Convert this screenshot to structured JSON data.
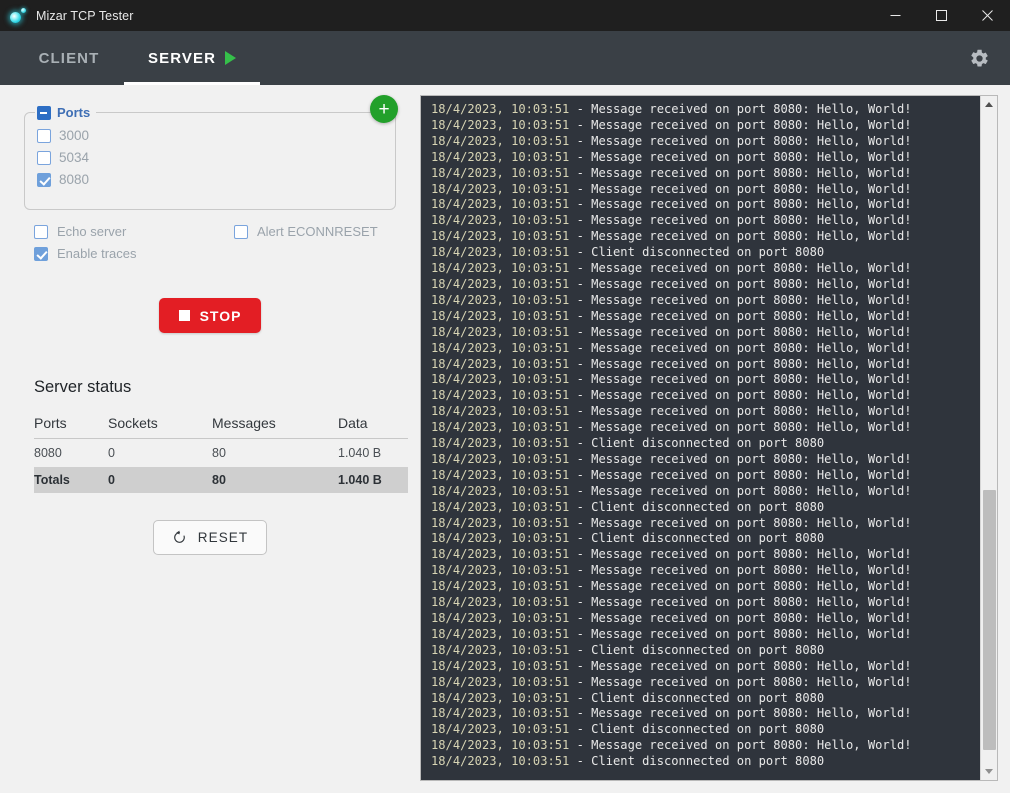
{
  "window": {
    "title": "Mizar TCP Tester",
    "controls": {
      "minimize": "minimize-icon",
      "maximize": "maximize-icon",
      "close": "close-icon"
    }
  },
  "tabs": [
    {
      "label": "CLIENT",
      "active": false,
      "icon": null
    },
    {
      "label": "SERVER",
      "active": true,
      "icon": "play-icon"
    }
  ],
  "toolbar": {
    "settings_icon": "gear-icon"
  },
  "ports_panel": {
    "legend": "Ports",
    "legend_state": "indeterminate",
    "add_button": "+",
    "items": [
      {
        "label": "3000",
        "checked": false
      },
      {
        "label": "5034",
        "checked": false
      },
      {
        "label": "8080",
        "checked": true
      }
    ]
  },
  "options": [
    {
      "label": "Echo server",
      "checked": false
    },
    {
      "label": "Enable traces",
      "checked": true
    },
    {
      "label": "Alert ECONNRESET",
      "checked": false
    }
  ],
  "stop_button": {
    "label": "STOP",
    "icon": "stop-square-icon",
    "color": "#e31e24"
  },
  "server_status": {
    "title": "Server status",
    "columns": [
      "Ports",
      "Sockets",
      "Messages",
      "Data"
    ],
    "rows": [
      [
        "8080",
        "0",
        "80",
        "1.040 B"
      ]
    ],
    "totals": [
      "Totals",
      "0",
      "80",
      "1.040 B"
    ]
  },
  "reset_button": {
    "label": "RESET",
    "icon": "refresh-icon"
  },
  "console": {
    "timestamp": "18/4/2023, 10:03:51",
    "separator": "-",
    "messages": {
      "received": "Message received on port 8080: Hello, World!",
      "disconnected": "Client disconnected on port 8080"
    },
    "lines": [
      "18/4/2023, 10:03:51 - Message received on port 8080: Hello, World!",
      "18/4/2023, 10:03:51 - Message received on port 8080: Hello, World!",
      "18/4/2023, 10:03:51 - Message received on port 8080: Hello, World!",
      "18/4/2023, 10:03:51 - Message received on port 8080: Hello, World!",
      "18/4/2023, 10:03:51 - Message received on port 8080: Hello, World!",
      "18/4/2023, 10:03:51 - Message received on port 8080: Hello, World!",
      "18/4/2023, 10:03:51 - Message received on port 8080: Hello, World!",
      "18/4/2023, 10:03:51 - Message received on port 8080: Hello, World!",
      "18/4/2023, 10:03:51 - Message received on port 8080: Hello, World!",
      "18/4/2023, 10:03:51 - Client disconnected on port 8080",
      "18/4/2023, 10:03:51 - Message received on port 8080: Hello, World!",
      "18/4/2023, 10:03:51 - Message received on port 8080: Hello, World!",
      "18/4/2023, 10:03:51 - Message received on port 8080: Hello, World!",
      "18/4/2023, 10:03:51 - Message received on port 8080: Hello, World!",
      "18/4/2023, 10:03:51 - Message received on port 8080: Hello, World!",
      "18/4/2023, 10:03:51 - Message received on port 8080: Hello, World!",
      "18/4/2023, 10:03:51 - Message received on port 8080: Hello, World!",
      "18/4/2023, 10:03:51 - Message received on port 8080: Hello, World!",
      "18/4/2023, 10:03:51 - Message received on port 8080: Hello, World!",
      "18/4/2023, 10:03:51 - Message received on port 8080: Hello, World!",
      "18/4/2023, 10:03:51 - Message received on port 8080: Hello, World!",
      "18/4/2023, 10:03:51 - Client disconnected on port 8080",
      "18/4/2023, 10:03:51 - Message received on port 8080: Hello, World!",
      "18/4/2023, 10:03:51 - Message received on port 8080: Hello, World!",
      "18/4/2023, 10:03:51 - Message received on port 8080: Hello, World!",
      "18/4/2023, 10:03:51 - Client disconnected on port 8080",
      "18/4/2023, 10:03:51 - Message received on port 8080: Hello, World!",
      "18/4/2023, 10:03:51 - Client disconnected on port 8080",
      "18/4/2023, 10:03:51 - Message received on port 8080: Hello, World!",
      "18/4/2023, 10:03:51 - Message received on port 8080: Hello, World!",
      "18/4/2023, 10:03:51 - Message received on port 8080: Hello, World!",
      "18/4/2023, 10:03:51 - Message received on port 8080: Hello, World!",
      "18/4/2023, 10:03:51 - Message received on port 8080: Hello, World!",
      "18/4/2023, 10:03:51 - Message received on port 8080: Hello, World!",
      "18/4/2023, 10:03:51 - Client disconnected on port 8080",
      "18/4/2023, 10:03:51 - Message received on port 8080: Hello, World!",
      "18/4/2023, 10:03:51 - Message received on port 8080: Hello, World!",
      "18/4/2023, 10:03:51 - Client disconnected on port 8080",
      "18/4/2023, 10:03:51 - Message received on port 8080: Hello, World!",
      "18/4/2023, 10:03:51 - Client disconnected on port 8080",
      "18/4/2023, 10:03:51 - Message received on port 8080: Hello, World!",
      "18/4/2023, 10:03:51 - Client disconnected on port 8080"
    ],
    "scrollbar": {
      "thumb_top_pct": 58,
      "thumb_height_pct": 40
    }
  }
}
